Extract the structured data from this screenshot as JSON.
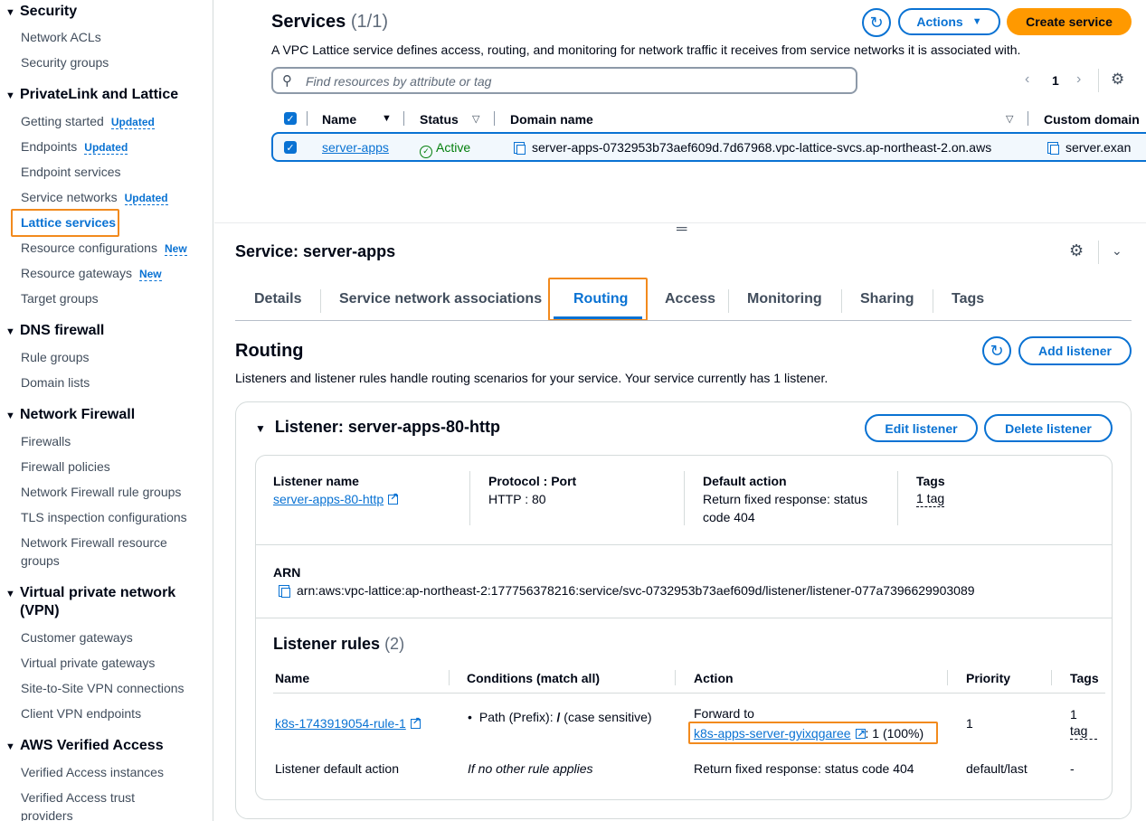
{
  "sidebar": {
    "sections": [
      {
        "title": "Security",
        "items": [
          {
            "label": "Network ACLs"
          },
          {
            "label": "Security groups"
          }
        ]
      },
      {
        "title": "PrivateLink and Lattice",
        "items": [
          {
            "label": "Getting started",
            "badge": "Updated"
          },
          {
            "label": "Endpoints",
            "badge": "Updated"
          },
          {
            "label": "Endpoint services"
          },
          {
            "label": "Service networks",
            "badge": "Updated"
          },
          {
            "label": "Lattice services"
          },
          {
            "label": "Resource configurations",
            "badge": "New"
          },
          {
            "label": "Resource gateways",
            "badge": "New"
          },
          {
            "label": "Target groups"
          }
        ]
      },
      {
        "title": "DNS firewall",
        "items": [
          {
            "label": "Rule groups"
          },
          {
            "label": "Domain lists"
          }
        ]
      },
      {
        "title": "Network Firewall",
        "items": [
          {
            "label": "Firewalls"
          },
          {
            "label": "Firewall policies"
          },
          {
            "label": "Network Firewall rule groups"
          },
          {
            "label": "TLS inspection configurations"
          },
          {
            "label": "Network Firewall resource groups"
          }
        ]
      },
      {
        "title": "Virtual private network (VPN)",
        "items": [
          {
            "label": "Customer gateways"
          },
          {
            "label": "Virtual private gateways"
          },
          {
            "label": "Site-to-Site VPN connections"
          },
          {
            "label": "Client VPN endpoints"
          }
        ]
      },
      {
        "title": "AWS Verified Access",
        "items": [
          {
            "label": "Verified Access instances"
          },
          {
            "label": "Verified Access trust providers"
          }
        ]
      }
    ]
  },
  "services": {
    "title": "Services",
    "count": "(1/1)",
    "description": "A VPC Lattice service defines access, routing, and monitoring for network traffic it receives from service networks it is associated with.",
    "actions_label": "Actions",
    "create_label": "Create service",
    "search_placeholder": "Find resources by attribute or tag",
    "page": "1",
    "columns": [
      "Name",
      "Status",
      "Domain name",
      "Custom domain"
    ],
    "row": {
      "name": "server-apps",
      "status": "Active",
      "domain": "server-apps-0732953b73aef609d.7d67968.vpc-lattice-svcs.ap-northeast-2.on.aws",
      "custom_domain": "server.exan"
    }
  },
  "service_detail": {
    "title": "Service: server-apps",
    "tabs": [
      "Details",
      "Service network associations",
      "Routing",
      "Access",
      "Monitoring",
      "Sharing",
      "Tags"
    ],
    "routing_title": "Routing",
    "add_listener_label": "Add listener",
    "routing_description": "Listeners and listener rules handle routing scenarios for your service. Your service currently has 1 listener."
  },
  "listener": {
    "title": "Listener: server-apps-80-http",
    "edit_label": "Edit listener",
    "delete_label": "Delete listener",
    "name_label": "Listener name",
    "name_value": "server-apps-80-http",
    "protocol_label": "Protocol : Port",
    "protocol_value": "HTTP : 80",
    "default_action_label": "Default action",
    "default_action_value": "Return fixed response: status code 404",
    "tags_label": "Tags",
    "tags_value": "1 tag",
    "arn_label": "ARN",
    "arn_value": "arn:aws:vpc-lattice:ap-northeast-2:177756378216:service/svc-0732953b73aef609d/listener/listener-077a7396629903089"
  },
  "rules": {
    "title": "Listener rules",
    "count": "(2)",
    "columns": [
      "Name",
      "Conditions (match all)",
      "Action",
      "Priority",
      "Tags"
    ],
    "rows": [
      {
        "name": "k8s-1743919054-rule-1",
        "condition_prefix": "Path (Prefix): ",
        "condition_value": "/",
        "condition_suffix": " (case sensitive)",
        "action_label": "Forward to",
        "action_target": "k8s-apps-server-gyixqgaree",
        "action_weight": ": 1 (100%)",
        "priority": "1",
        "tags": "1 tag"
      },
      {
        "name": "Listener default action",
        "condition": "If no other rule applies",
        "action": "Return fixed response: status code 404",
        "priority": "default/last",
        "tags": "-"
      }
    ]
  }
}
